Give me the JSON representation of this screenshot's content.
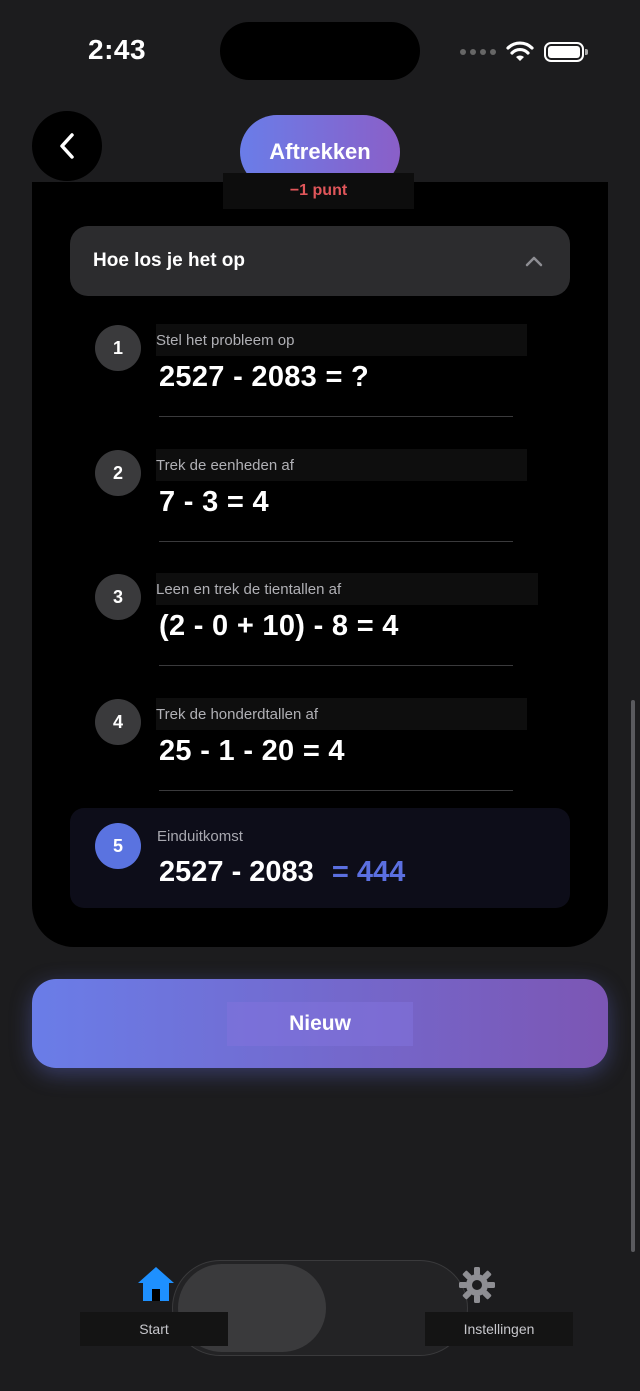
{
  "status_bar": {
    "time": "2:43"
  },
  "header": {
    "title": "Aftrekken",
    "penalty": "−1 punt"
  },
  "accordion": {
    "title": "Hoe los je het op"
  },
  "steps": [
    {
      "number": "1",
      "label": "Stel het probleem op",
      "equation": "2527 - 2083  = ?"
    },
    {
      "number": "2",
      "label": "Trek de eenheden af",
      "equation": "7 - 3  = 4"
    },
    {
      "number": "3",
      "label": "Leen en trek de tientallen af",
      "equation": "(2 - 0 + 10) - 8  = 4"
    },
    {
      "number": "4",
      "label": "Trek de honderdtallen af",
      "equation": "25 - 1 - 20  = 4"
    }
  ],
  "final": {
    "number": "5",
    "label": "Einduitkomst",
    "equation": "2527 - 2083",
    "answer": "= 444"
  },
  "new_button": {
    "label": "Nieuw"
  },
  "tab_bar": {
    "start_label": "Start",
    "settings_label": "Instellingen"
  },
  "colors": {
    "accent": "#5b6fe0",
    "gradient_start": "#6a7de8",
    "gradient_end": "#7c56b4",
    "penalty": "#e0565a",
    "home_icon": "#1e90ff"
  }
}
